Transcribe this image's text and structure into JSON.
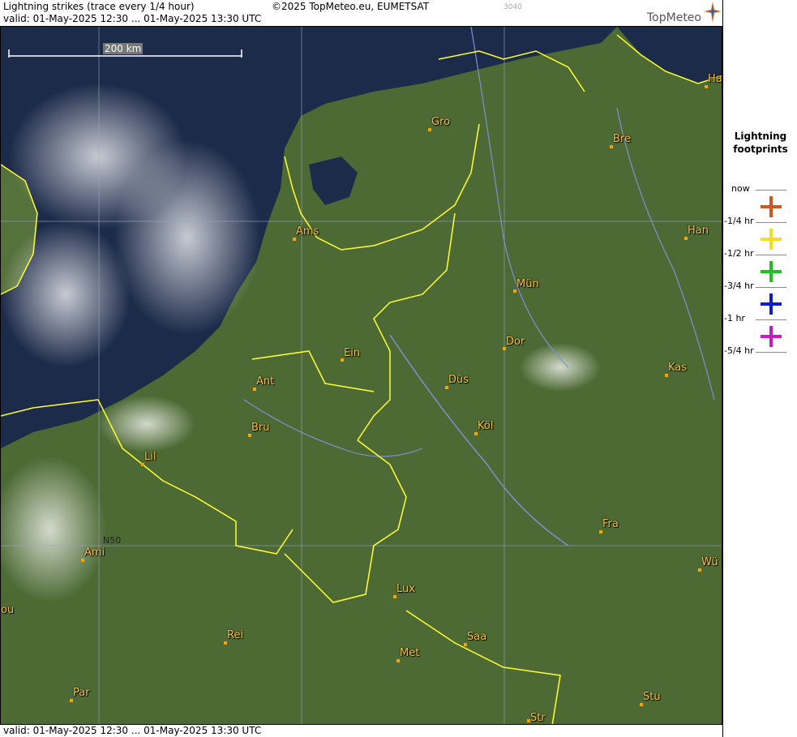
{
  "header": {
    "title": "Lightning strikes (trace every 1/4 hour)",
    "copyright": "©2025 TopMeteo.eu, EUMETSAT",
    "image_id": "3040",
    "valid": "valid:  01-May-2025 12:30 ... 01-May-2025 13:30 UTC",
    "logo": "TopMeteo"
  },
  "footer": {
    "valid": "valid:  01-May-2025 12:30 ... 01-May-2025 13:30 UTC"
  },
  "map": {
    "scale_label": "200 km",
    "grid_label": "N50",
    "cities": [
      "Gro",
      "Bre",
      "Ha",
      "Ams",
      "Han",
      "Mün",
      "Dor",
      "Ein",
      "Ant",
      "Kas",
      "Düs",
      "Bru",
      "Köl",
      "Lil",
      "Fra",
      "Ami",
      "Wü",
      "Lux",
      "Saa",
      "ou",
      "Rei",
      "Met",
      "Par",
      "Stu",
      "Str"
    ]
  },
  "legend": {
    "title_line1": "Lightning",
    "title_line2": "footprints",
    "labels": [
      "now",
      "-1/4 hr",
      "-1/2 hr",
      "-3/4 hr",
      "-1 hr",
      "-5/4 hr"
    ],
    "colors": [
      "#d2561e",
      "#f0e020",
      "#20c020",
      "#1020c0",
      "#c020c0"
    ]
  }
}
